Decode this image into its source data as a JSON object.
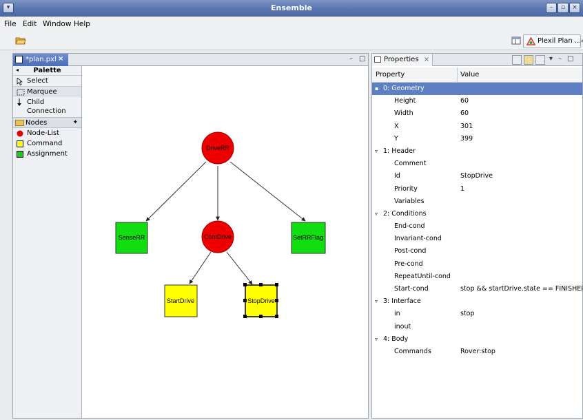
{
  "window": {
    "title": "Ensemble",
    "controls": [
      "–",
      "▫",
      "×"
    ]
  },
  "menu": [
    "File",
    "Edit",
    "Window",
    "Help"
  ],
  "toolbar": {
    "open_icon": "folder-open-icon",
    "perspective_label": "Plexil Plan ...",
    "overflow": "»"
  },
  "editor": {
    "tab_label": "*plan.pxl",
    "tab_close": "×",
    "minimize": "–",
    "maximize": "□"
  },
  "palette": {
    "title": "Palette",
    "tools": [
      {
        "label": "Select",
        "icon": "cursor-arrow-icon"
      },
      {
        "label": "Marquee",
        "icon": "marquee-icon"
      },
      {
        "label": "Child Connection",
        "icon": "connection-arrow-icon"
      }
    ],
    "drawer": {
      "label": "Nodes",
      "icon": "folder-icon"
    },
    "nodes": [
      {
        "label": "Node-List",
        "color": "#e00000",
        "shape": "circle"
      },
      {
        "label": "Command",
        "color": "#ffff00",
        "shape": "square"
      },
      {
        "label": "Assignment",
        "color": "#22c822",
        "shape": "square"
      }
    ]
  },
  "diagram": {
    "nodes": [
      {
        "label": "DriveRR",
        "kind": "node-list",
        "color": "#ee0000"
      },
      {
        "label": "SenseRR",
        "kind": "assignment",
        "color": "#11dd11"
      },
      {
        "label": "ContDrive",
        "kind": "node-list",
        "color": "#ee0000"
      },
      {
        "label": "SetRRFlag",
        "kind": "assignment",
        "color": "#11dd11"
      },
      {
        "label": "StartDrive",
        "kind": "command",
        "color": "#ffff00"
      },
      {
        "label": "StopDrive",
        "kind": "command",
        "color": "#ffff00",
        "selected": true
      }
    ],
    "edges": [
      [
        "DriveRR",
        "SenseRR"
      ],
      [
        "DriveRR",
        "ContDrive"
      ],
      [
        "DriveRR",
        "SetRRFlag"
      ],
      [
        "ContDrive",
        "StartDrive"
      ],
      [
        "ContDrive",
        "StopDrive"
      ]
    ]
  },
  "properties": {
    "tab_label": "Properties",
    "tab_close": "×",
    "columns": {
      "property": "Property",
      "value": "Value"
    },
    "rows": [
      {
        "type": "cat",
        "key": "0: Geometry",
        "selected": true
      },
      {
        "type": "leaf",
        "key": "Height",
        "value": "60"
      },
      {
        "type": "leaf",
        "key": "Width",
        "value": "60"
      },
      {
        "type": "leaf",
        "key": "X",
        "value": "301"
      },
      {
        "type": "leaf",
        "key": "Y",
        "value": "399"
      },
      {
        "type": "cat",
        "key": "1: Header"
      },
      {
        "type": "leaf",
        "key": "Comment",
        "value": ""
      },
      {
        "type": "leaf",
        "key": "Id",
        "value": "StopDrive"
      },
      {
        "type": "leaf",
        "key": "Priority",
        "value": "1"
      },
      {
        "type": "leaf",
        "key": "Variables",
        "value": ""
      },
      {
        "type": "cat",
        "key": "2: Conditions"
      },
      {
        "type": "leaf",
        "key": "End-cond",
        "value": ""
      },
      {
        "type": "leaf",
        "key": "Invariant-cond",
        "value": ""
      },
      {
        "type": "leaf",
        "key": "Post-cond",
        "value": ""
      },
      {
        "type": "leaf",
        "key": "Pre-cond",
        "value": ""
      },
      {
        "type": "leaf",
        "key": "RepeatUntil-cond",
        "value": ""
      },
      {
        "type": "leaf",
        "key": "Start-cond",
        "value": "stop && startDrive.state == FINISHED"
      },
      {
        "type": "cat",
        "key": "3: Interface"
      },
      {
        "type": "leaf",
        "key": "in",
        "value": "stop"
      },
      {
        "type": "leaf",
        "key": "inout",
        "value": ""
      },
      {
        "type": "cat",
        "key": "4: Body"
      },
      {
        "type": "leaf",
        "key": "Commands",
        "value": "Rover:stop"
      }
    ]
  }
}
